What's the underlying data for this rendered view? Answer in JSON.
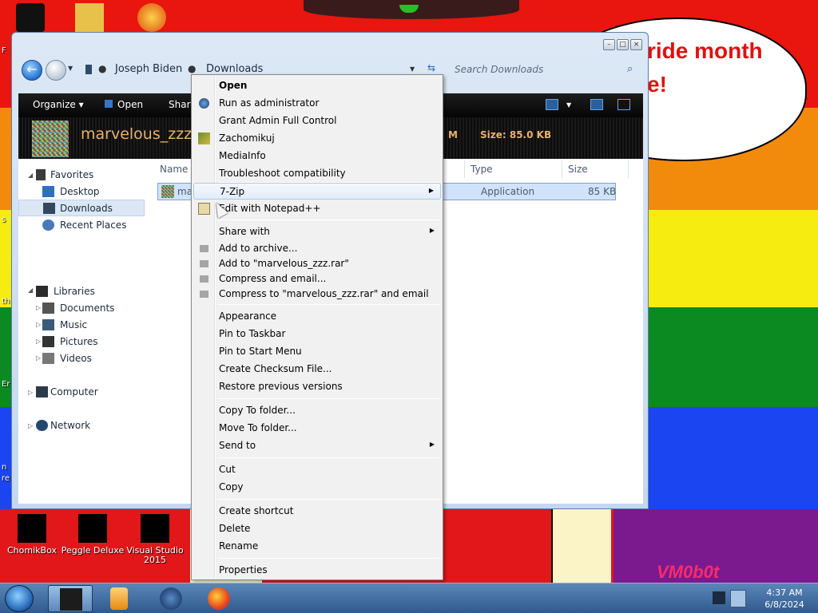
{
  "desktop": {
    "bubble_line1": "ride month",
    "bubble_line2": "e!",
    "icons": [
      {
        "label": "ChomikBox"
      },
      {
        "label": "Peggle Deluxe"
      },
      {
        "label": "Visual Studio 2015"
      }
    ],
    "edge_fragments": [
      "F",
      "s",
      "th",
      "Er",
      "n",
      "re"
    ],
    "watermark": "VM0b0t"
  },
  "window": {
    "breadcrumbs": [
      "Joseph Biden",
      "Downloads"
    ],
    "search_placeholder": "Search Downloads",
    "toolbar": {
      "organize": "Organize",
      "open": "Open",
      "share": "Share"
    },
    "details": {
      "filename": "marvelous_zzz.",
      "modified_fragment": "M",
      "size": "Size: 85.0 KB"
    },
    "nav": {
      "favorites": "Favorites",
      "desktop": "Desktop",
      "downloads": "Downloads",
      "recent": "Recent Places",
      "libraries": "Libraries",
      "documents": "Documents",
      "music": "Music",
      "pictures": "Pictures",
      "videos": "Videos",
      "computer": "Computer",
      "network": "Network"
    },
    "columns": {
      "name": "Name",
      "type": "Type",
      "size": "Size"
    },
    "file": {
      "name": "ma",
      "type": "Application",
      "size": "85 KB"
    }
  },
  "context_menu": {
    "items": [
      "Open",
      "Run as administrator",
      "Grant Admin Full Control",
      "Zachomikuj",
      "MediaInfo",
      "Troubleshoot compatibility",
      "7-Zip",
      "Edit with Notepad++",
      "Share with",
      "Add to archive...",
      "Add to \"marvelous_zzz.rar\"",
      "Compress and email...",
      "Compress to \"marvelous_zzz.rar\" and email",
      "Appearance",
      "Pin to Taskbar",
      "Pin to Start Menu",
      "Create Checksum File...",
      "Restore previous versions",
      "Copy To folder...",
      "Move To folder...",
      "Send to",
      "Cut",
      "Copy",
      "Create shortcut",
      "Delete",
      "Rename",
      "Properties"
    ],
    "highlighted_item": "7-Zip"
  },
  "taskbar": {
    "time": "4:37 AM",
    "date": "6/8/2024"
  },
  "colors": {
    "accent": "#2a6bb6",
    "highlight": "#cfe3fb",
    "details_text": "#e9b26d"
  }
}
